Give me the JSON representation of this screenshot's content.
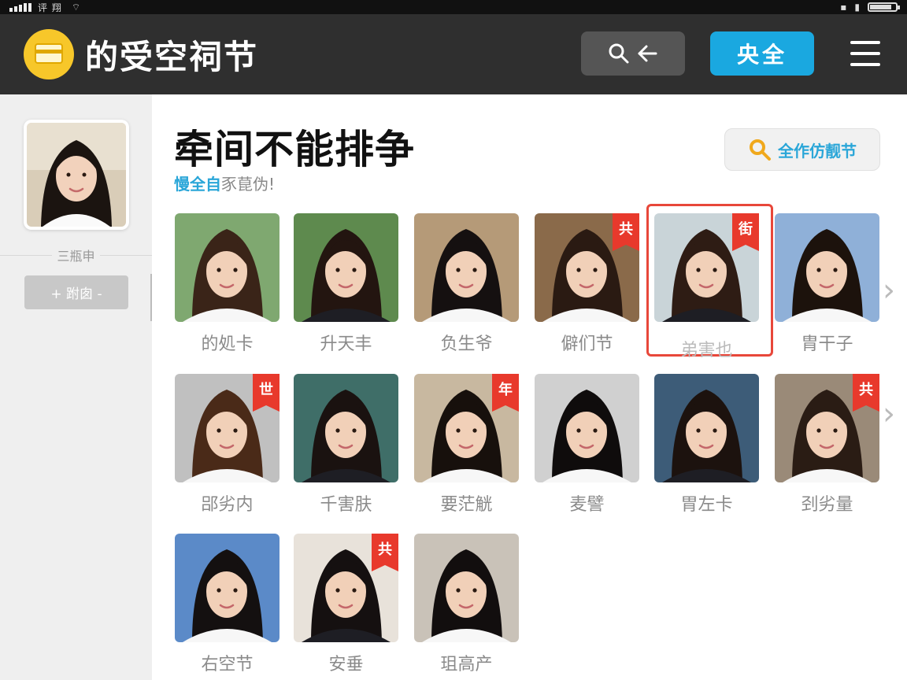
{
  "status_bar": {
    "text": "评 翔"
  },
  "header": {
    "title": "的受空祠节",
    "primary_button": "央全",
    "search_icon": "search-icon",
    "back_icon": "arrow-left-icon",
    "menu_icon": "hamburger-menu-icon"
  },
  "sidebar": {
    "label": "三瓶申",
    "button": "+ 跗囱 -"
  },
  "main": {
    "title": "牵间不能排争",
    "subtitle_accent": "慢全自",
    "subtitle_rest": "豕菎伪!",
    "filter_button": "全作仿靓节"
  },
  "profiles": [
    {
      "name": "的処卡",
      "tag": "",
      "bg": "#7fa870"
    },
    {
      "name": "升天丰",
      "tag": "",
      "bg": "#5e8a4e"
    },
    {
      "name": "负生爷",
      "tag": "",
      "bg": "#b59a78"
    },
    {
      "name": "僻们节",
      "tag": "共",
      "bg": "#8a6a4a"
    },
    {
      "name": "弟害也",
      "tag": "街",
      "bg": "#c9d4d8",
      "selected": true
    },
    {
      "name": "胄干子",
      "tag": "",
      "bg": "#8fb0d8"
    },
    {
      "name": "郘劣内",
      "tag": "世",
      "bg": "#c0c0c0"
    },
    {
      "name": "千害肤",
      "tag": "",
      "bg": "#3f6e68"
    },
    {
      "name": "要茫觥",
      "tag": "年",
      "bg": "#c8b8a0"
    },
    {
      "name": "麦譬",
      "tag": "",
      "bg": "#d0d0d0"
    },
    {
      "name": "胃左卡",
      "tag": "",
      "bg": "#3d5c78"
    },
    {
      "name": "刭劣量",
      "tag": "共",
      "bg": "#9a8a78"
    },
    {
      "name": "右空节",
      "tag": "",
      "bg": "#5b8ac8"
    },
    {
      "name": "安垂",
      "tag": "共",
      "bg": "#e8e2da"
    },
    {
      "name": "珇高产",
      "tag": "",
      "bg": "#c9c2b8"
    }
  ],
  "colors": {
    "accent": "#1aa8e0",
    "tag": "#e8392c",
    "selection": "#e8473a"
  }
}
